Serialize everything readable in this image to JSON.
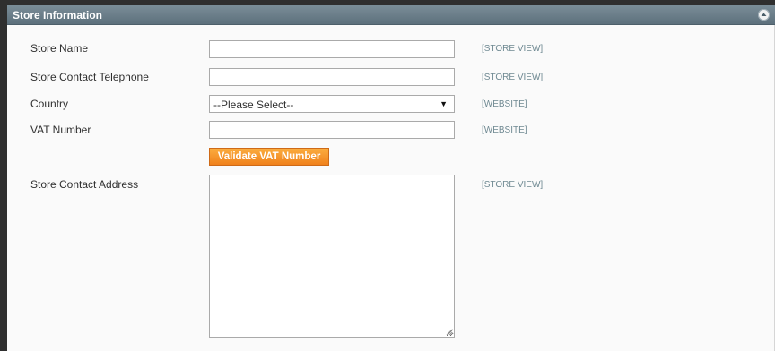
{
  "section": {
    "title": "Store Information",
    "collapse_icon": "chevron-up-circle-icon"
  },
  "fields": {
    "store_name": {
      "label": "Store Name",
      "value": "",
      "scope": "[STORE VIEW]"
    },
    "store_phone": {
      "label": "Store Contact Telephone",
      "value": "",
      "scope": "[STORE VIEW]"
    },
    "country": {
      "label": "Country",
      "selected": "--Please Select--",
      "scope": "[WEBSITE]"
    },
    "vat_number": {
      "label": "VAT Number",
      "value": "",
      "scope": "[WEBSITE]"
    },
    "validate_vat": {
      "label": "Validate VAT Number"
    },
    "store_address": {
      "label": "Store Contact Address",
      "value": "",
      "scope": "[STORE VIEW]"
    }
  },
  "colors": {
    "header_bg": "#6a7d89",
    "button_accent": "#f0811c",
    "scope_text": "#6f8992"
  }
}
